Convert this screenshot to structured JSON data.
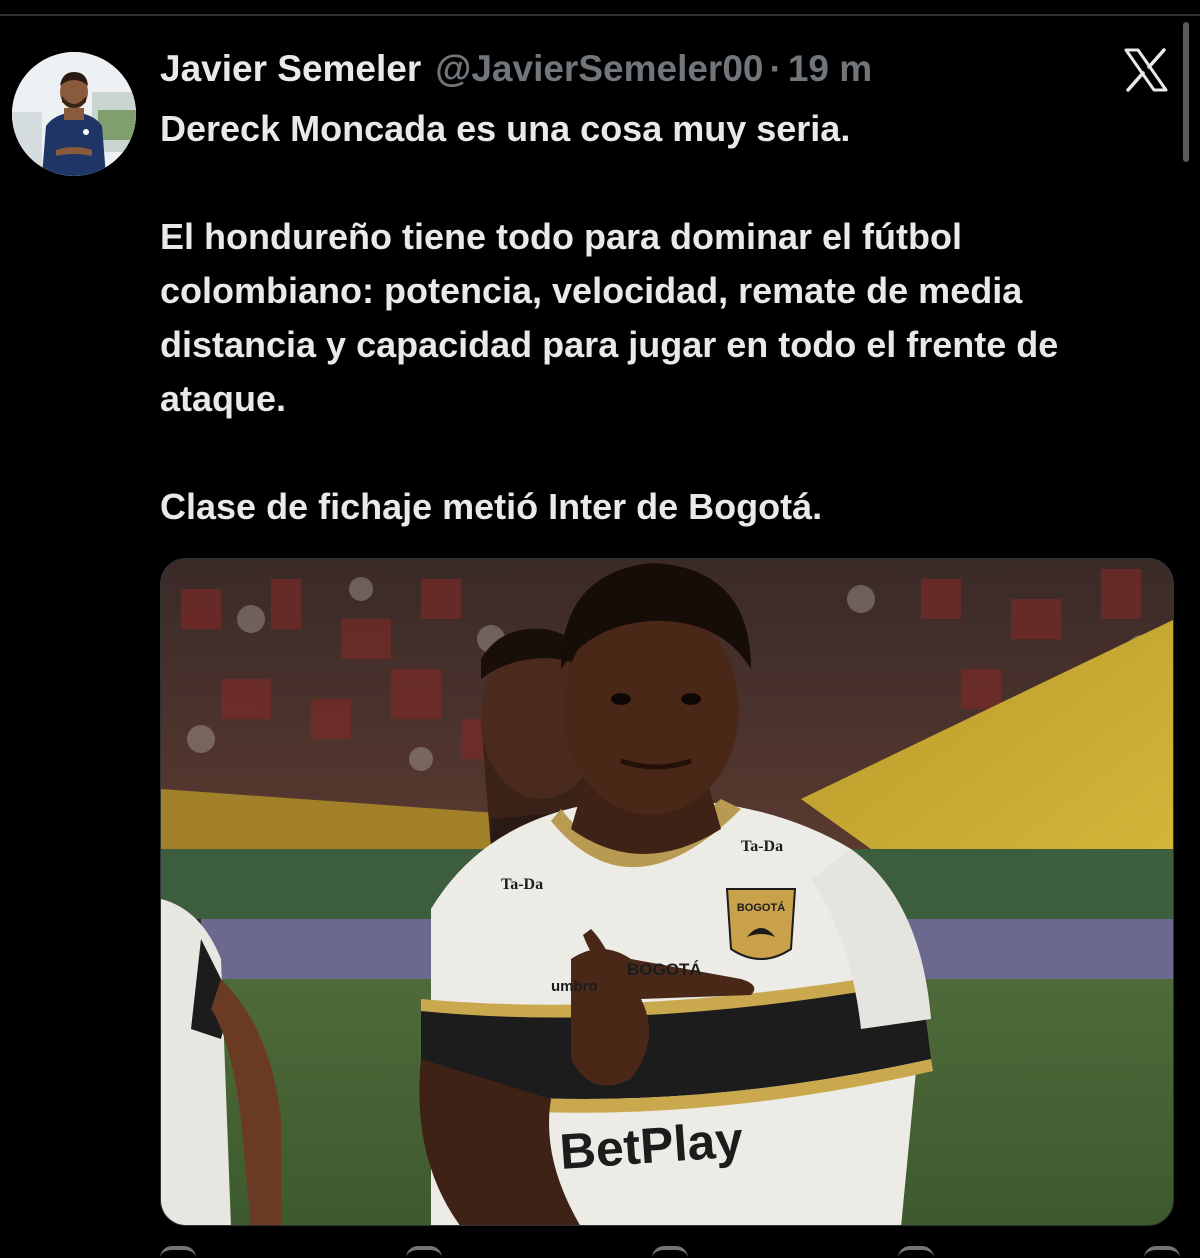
{
  "post": {
    "author": {
      "display_name": "Javier Semeler",
      "handle": "@JavierSemeler00",
      "separator": "·",
      "time": "19 m"
    },
    "text": {
      "p1": "Dereck Moncada es una cosa muy seria.",
      "p2": "El hondureño tiene todo para dominar el fútbol colombiano: potencia, velocidad, remate de media distancia y capacidad para jugar en todo el frente de ataque.",
      "p3": "Clase de fichaje metió Inter de Bogotá."
    },
    "media": {
      "jersey_brand": "Ta-Da",
      "jersey_sponsor": "BetPlay",
      "jersey_city": "BOGOTÁ",
      "jersey_maker": "umbro",
      "crest_text": "BOGOTÁ"
    }
  },
  "icons": {
    "platform_logo": "x-logo-icon"
  },
  "colors": {
    "background": "#000000",
    "text_primary": "#e7e9ea",
    "text_secondary": "#71767b",
    "border": "#2f3336"
  }
}
